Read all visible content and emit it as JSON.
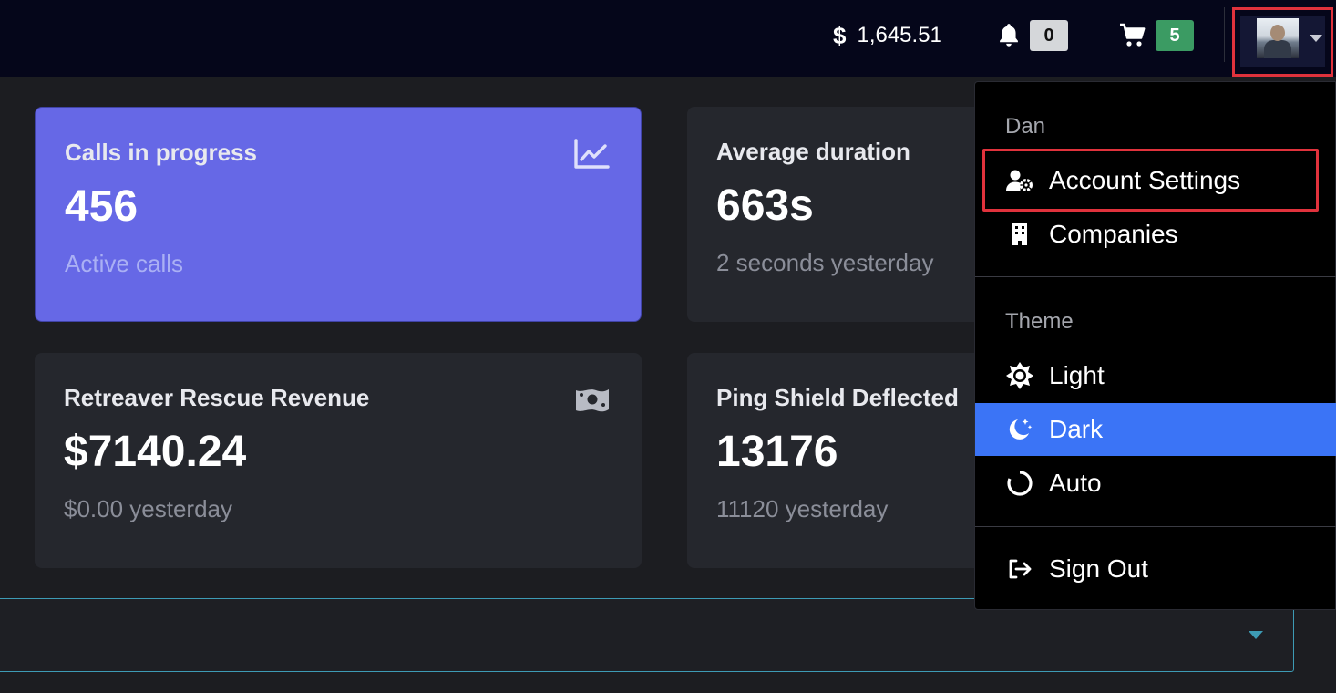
{
  "topbar": {
    "balance_symbol": "$",
    "balance": "1,645.51",
    "notifications_count": "0",
    "cart_count": "5"
  },
  "cards": [
    {
      "title": "Calls in progress",
      "value": "456",
      "sub": "Active calls",
      "icon": "chart-line-icon"
    },
    {
      "title": "Average duration",
      "value": "663s",
      "sub": "2 seconds yesterday",
      "icon": ""
    },
    {
      "title": "Retreaver Rescue Revenue",
      "value": "$7140.24",
      "sub": "$0.00 yesterday",
      "icon": "money-bill-icon"
    },
    {
      "title": "Ping Shield Deflected",
      "value": "13176",
      "sub": "11120 yesterday",
      "icon": ""
    }
  ],
  "menu": {
    "user_header": "Dan",
    "account_settings": "Account Settings",
    "companies": "Companies",
    "theme_header": "Theme",
    "light": "Light",
    "dark": "Dark",
    "auto": "Auto",
    "sign_out": "Sign Out",
    "active_theme": "dark"
  },
  "colors": {
    "topbar_bg": "#05061a",
    "page_bg": "#1c1d21",
    "card_bg": "#25272d",
    "primary_card": "#6668e6",
    "active_menu": "#3b74f6",
    "cart_badge": "#3b9b63",
    "highlight": "#e0323c"
  }
}
